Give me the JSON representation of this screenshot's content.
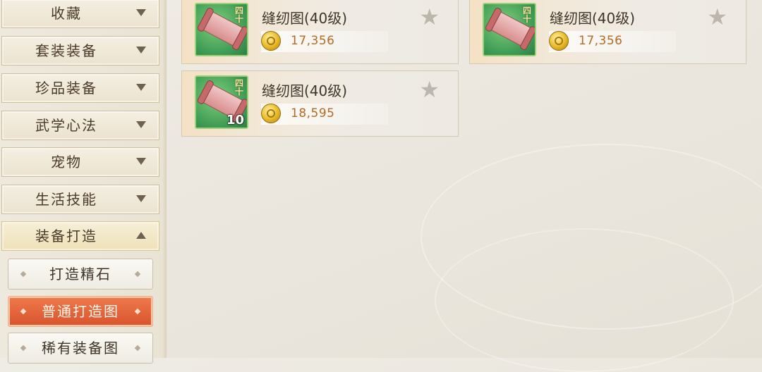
{
  "sidebar": {
    "categories": [
      {
        "label": "收藏",
        "arrow": "down"
      },
      {
        "label": "套装装备",
        "arrow": "down"
      },
      {
        "label": "珍品装备",
        "arrow": "down"
      },
      {
        "label": "武学心法",
        "arrow": "down"
      },
      {
        "label": "宠物",
        "arrow": "down"
      },
      {
        "label": "生活技能",
        "arrow": "down"
      },
      {
        "label": "装备打造",
        "arrow": "up",
        "active": true
      }
    ],
    "subitems": [
      {
        "label": "打造精石"
      },
      {
        "label": "普通打造图",
        "selected": true
      },
      {
        "label": "稀有装备图"
      }
    ]
  },
  "items": [
    {
      "name": "缝纫图(40级)",
      "price": "17,356",
      "tag": "四十",
      "quantity": "",
      "icon": "scroll-icon"
    },
    {
      "name": "缝纫图(40级)",
      "price": "17,356",
      "tag": "四十",
      "quantity": "",
      "icon": "scroll-icon"
    },
    {
      "name": "缝纫图(40级)",
      "price": "18,595",
      "tag": "四十",
      "quantity": "10",
      "icon": "scroll-icon"
    }
  ],
  "colors": {
    "selected_subitem": "#d9532c",
    "price_text": "#b46b24",
    "icon_bg": "#3d9a53"
  }
}
